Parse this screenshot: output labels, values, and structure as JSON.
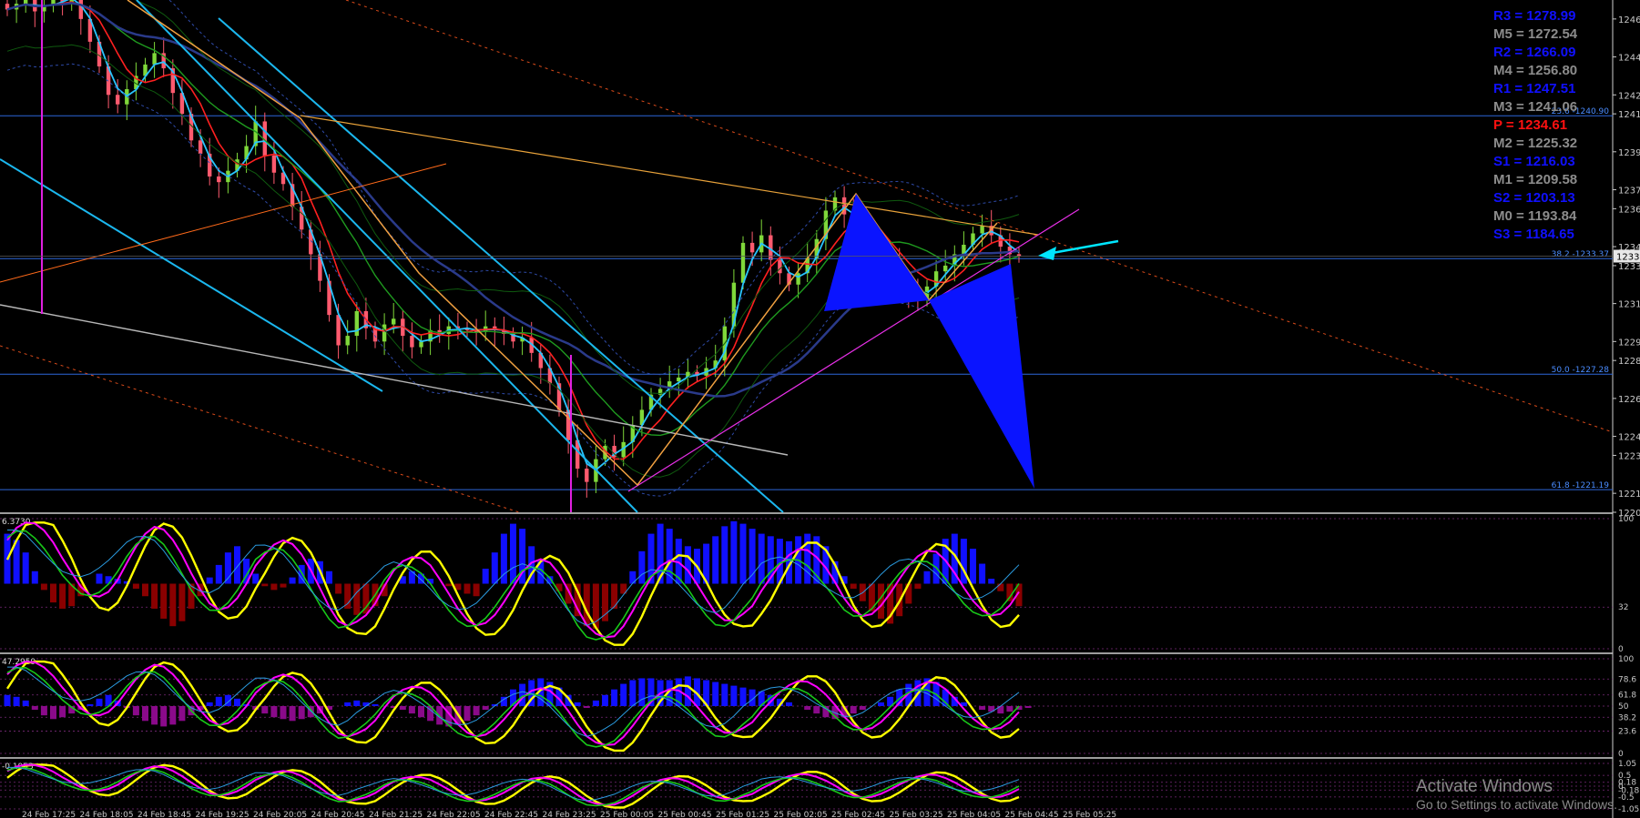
{
  "chart_data": {
    "type": "candlestick",
    "price_axis": {
      "range": [
        1220,
        1247
      ],
      "tick_labels": [
        "1246",
        "1244",
        "1242",
        "1241",
        "1239",
        "1237",
        "1236",
        "1234",
        "1233",
        "1231",
        "1229",
        "1228",
        "1226",
        "1224",
        "1223",
        "1221",
        "1220"
      ],
      "current_price_label": "1233"
    },
    "time_axis": {
      "tick_labels": [
        "24 Feb 17:25",
        "24 Feb 18:05",
        "24 Feb 18:45",
        "24 Feb 19:25",
        "24 Feb 20:05",
        "24 Feb 20:45",
        "24 Feb 21:25",
        "24 Feb 22:05",
        "24 Feb 22:45",
        "24 Feb 23:25",
        "25 Feb 00:05",
        "25 Feb 00:45",
        "25 Feb 01:25",
        "25 Feb 02:05",
        "25 Feb 02:45",
        "25 Feb 03:25",
        "25 Feb 04:05",
        "25 Feb 04:45",
        "25 Feb 05:25"
      ]
    },
    "pivot_levels": [
      {
        "label": "R3 = 1278.99",
        "value": 1278.99,
        "color": "#1010ff"
      },
      {
        "label": "M5 = 1272.54",
        "value": 1272.54,
        "color": "#8c8c8c"
      },
      {
        "label": "R2 = 1266.09",
        "value": 1266.09,
        "color": "#1010ff"
      },
      {
        "label": "M4 = 1256.80",
        "value": 1256.8,
        "color": "#8c8c8c"
      },
      {
        "label": "R1 = 1247.51",
        "value": 1247.51,
        "color": "#1010ff"
      },
      {
        "label": "M3 = 1241.06",
        "value": 1241.06,
        "color": "#8c8c8c"
      },
      {
        "label": "P  = 1234.61",
        "value": 1234.61,
        "color": "#ff1010"
      },
      {
        "label": "M2 = 1225.32",
        "value": 1225.32,
        "color": "#8c8c8c"
      },
      {
        "label": "S1 = 1216.03",
        "value": 1216.03,
        "color": "#1010ff"
      },
      {
        "label": "M1 = 1209.58",
        "value": 1209.58,
        "color": "#8c8c8c"
      },
      {
        "label": "S2 = 1203.13",
        "value": 1203.13,
        "color": "#1010ff"
      },
      {
        "label": "M0 = 1193.84",
        "value": 1193.84,
        "color": "#8c8c8c"
      },
      {
        "label": "S3 = 1184.65",
        "value": 1184.65,
        "color": "#1010ff"
      }
    ],
    "fib_levels": [
      {
        "label": "23.6 -1240.90",
        "value": 1240.9
      },
      {
        "label": "38.2 -1233.37",
        "value": 1233.37
      },
      {
        "label": "50.0 -1227.28",
        "value": 1227.28
      },
      {
        "label": "61.8 -1221.19",
        "value": 1221.19
      }
    ],
    "closes": [
      1246.5,
      1246.8,
      1247.0,
      1246.4,
      1246.7,
      1247.1,
      1246.9,
      1247.3,
      1246.0,
      1244.8,
      1243.5,
      1242.0,
      1241.5,
      1242.3,
      1243.0,
      1243.6,
      1244.2,
      1243.4,
      1242.1,
      1241.0,
      1239.6,
      1238.9,
      1237.7,
      1237.4,
      1238.0,
      1238.6,
      1239.3,
      1240.6,
      1238.8,
      1237.9,
      1237.3,
      1236.1,
      1234.9,
      1233.6,
      1232.2,
      1230.4,
      1228.8,
      1229.3,
      1230.6,
      1229.7,
      1229.0,
      1229.9,
      1230.2,
      1229.3,
      1228.7,
      1229.0,
      1229.6,
      1229.4,
      1229.8,
      1229.7,
      1229.6,
      1229.5,
      1229.8,
      1229.6,
      1229.4,
      1229.0,
      1229.2,
      1228.4,
      1227.6,
      1226.8,
      1225.4,
      1223.8,
      1222.3,
      1221.6,
      1222.8,
      1223.5,
      1222.9,
      1223.7,
      1224.6,
      1225.4,
      1226.2,
      1226.5,
      1226.9,
      1227.1,
      1227.4,
      1227.2,
      1227.6,
      1228.0,
      1229.8,
      1232.1,
      1234.2,
      1233.7,
      1234.6,
      1233.3,
      1232.6,
      1232.0,
      1232.6,
      1233.4,
      1234.4,
      1235.9,
      1236.6,
      1235.7,
      1234.9,
      1234.3,
      1234.0,
      1233.7,
      1233.1,
      1232.3,
      1231.6,
      1231.2,
      1231.9,
      1232.7,
      1233.0,
      1233.6,
      1234.1,
      1234.7,
      1235.1,
      1234.6,
      1234.0,
      1233.6,
      1233.5
    ],
    "indicators": [
      {
        "name": "",
        "value_label": "6.3730",
        "levels": [
          "100",
          "32",
          "0"
        ],
        "levels_values": [
          100,
          32,
          0
        ],
        "histogram": [
          40,
          35,
          25,
          10,
          -5,
          -15,
          -20,
          -18,
          -10,
          0,
          8,
          6,
          4,
          2,
          -4,
          -10,
          -20,
          -28,
          -34,
          -30,
          -20,
          -10,
          5,
          15,
          25,
          30,
          20,
          8,
          -2,
          -5,
          -3,
          5,
          15,
          20,
          18,
          10,
          -8,
          -20,
          -25,
          -24,
          -18,
          -10,
          0,
          6,
          10,
          8,
          4,
          0,
          -2,
          -5,
          -8,
          -10,
          12,
          25,
          40,
          48,
          44,
          30,
          18,
          6,
          -6,
          -16,
          -26,
          -34,
          -36,
          -30,
          -20,
          -8,
          10,
          26,
          40,
          48,
          44,
          36,
          30,
          28,
          32,
          38,
          46,
          50,
          48,
          44,
          40,
          38,
          36,
          34,
          38,
          40,
          38,
          30,
          18,
          6,
          -4,
          -14,
          -22,
          -28,
          -32,
          -26,
          -16,
          -4,
          10,
          24,
          36,
          40,
          36,
          28,
          16,
          4,
          -6,
          -14,
          -18
        ]
      },
      {
        "name": "",
        "value_label": "47.2959",
        "levels": [
          "100",
          "78.6",
          "61.8",
          "50",
          "38.2",
          "23.6",
          "0"
        ],
        "levels_values": [
          100,
          78.6,
          61.8,
          50,
          38.2,
          23.6,
          0
        ],
        "histogram": [
          12,
          10,
          6,
          -4,
          -10,
          -14,
          -12,
          -8,
          -4,
          2,
          8,
          12,
          6,
          -2,
          -10,
          -16,
          -20,
          -22,
          -20,
          -16,
          -10,
          -4,
          4,
          10,
          12,
          8,
          2,
          -4,
          -8,
          -12,
          -14,
          -16,
          -14,
          -12,
          -8,
          -4,
          0,
          4,
          6,
          4,
          2,
          0,
          -2,
          -4,
          -8,
          -12,
          -16,
          -20,
          -22,
          -20,
          -16,
          -10,
          -4,
          2,
          10,
          18,
          24,
          28,
          30,
          26,
          20,
          12,
          4,
          -2,
          6,
          12,
          18,
          24,
          28,
          30,
          30,
          28,
          28,
          30,
          32,
          30,
          28,
          26,
          24,
          22,
          20,
          18,
          16,
          12,
          8,
          4,
          0,
          -4,
          -8,
          -12,
          -14,
          -12,
          -8,
          -4,
          0,
          4,
          10,
          18,
          24,
          28,
          30,
          26,
          18,
          10,
          4,
          0,
          -4,
          -6,
          -8,
          -6,
          -4,
          -2
        ]
      },
      {
        "name": "",
        "value_label": "-0.1053",
        "levels": [
          "1.05",
          "0.5",
          "0.18",
          "0",
          "-0.18",
          "-0.5",
          "-1.05"
        ],
        "levels_values": [
          1.05,
          0.5,
          0.18,
          0,
          -0.18,
          -0.5,
          -1.05
        ],
        "histogram": []
      }
    ],
    "annotations": {
      "watermark_title": "Activate Windows",
      "watermark_sub": "Go to Settings to activate Windows."
    },
    "colors": {
      "bull_candle": "#7fd83a",
      "bear_candle": "#ff5a6e",
      "fib_line": "#2c66d9",
      "fib_label": "#4a8cff",
      "channel_cyan": "#1bb7ee",
      "arrow": "#00e5ff",
      "pattern_fill": "#0a14ff",
      "hist_bull": "#1010ff",
      "hist_bear": "#8a0000",
      "hist_purple": "#8a0a8a",
      "osc_yellow": "#ffff00",
      "osc_magenta": "#ff00ff",
      "osc_green": "#18c818",
      "axis_text": "#c8c8c8"
    },
    "grid": false,
    "legend": "top-right"
  }
}
